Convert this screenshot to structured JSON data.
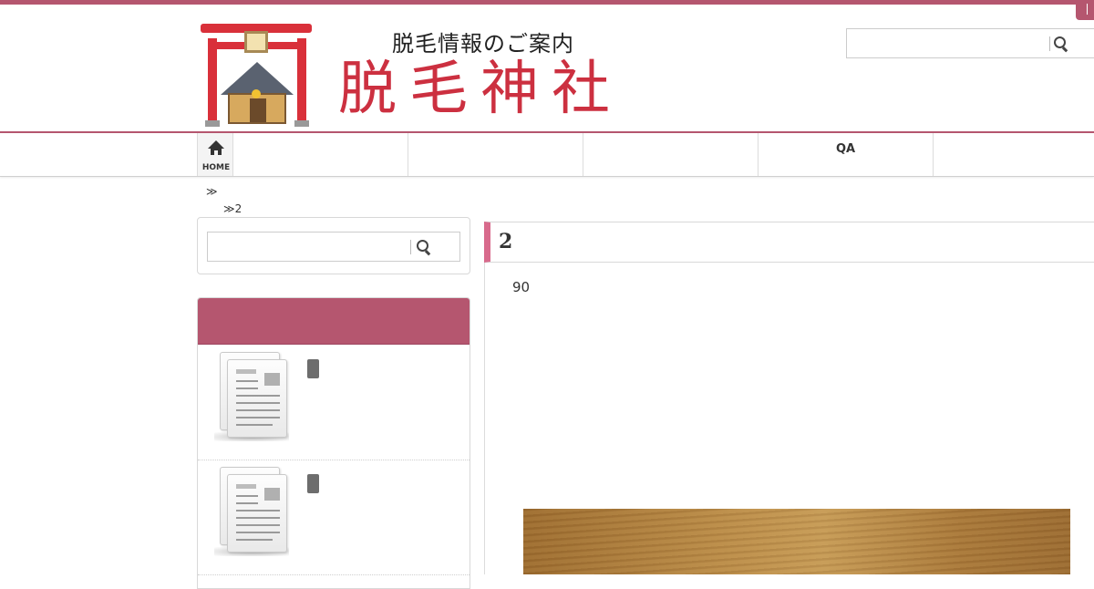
{
  "header": {
    "logo_subtitle": "脱毛情報のご案内",
    "logo_title": "脱毛神社",
    "search": {
      "placeholder": "",
      "value": ""
    }
  },
  "nav": {
    "home_label": "HOME",
    "items": [
      {
        "label": ""
      },
      {
        "label": ""
      },
      {
        "label": "QA"
      },
      {
        "label": ""
      }
    ]
  },
  "breadcrumb": {
    "level1": "≫",
    "level2": "≫2"
  },
  "sidebar": {
    "search": {
      "placeholder": "",
      "value": ""
    },
    "widget_title": "",
    "posts": [
      {
        "thumbnail_icon": "document-icon",
        "tag": ""
      },
      {
        "thumbnail_icon": "document-icon",
        "tag": ""
      }
    ]
  },
  "main": {
    "heading": "2",
    "text": "90",
    "image_icon": "wood-photo"
  },
  "colors": {
    "accent": "#b5566f",
    "heading_accent": "#d86a8c",
    "logo_red": "#cc3040"
  }
}
